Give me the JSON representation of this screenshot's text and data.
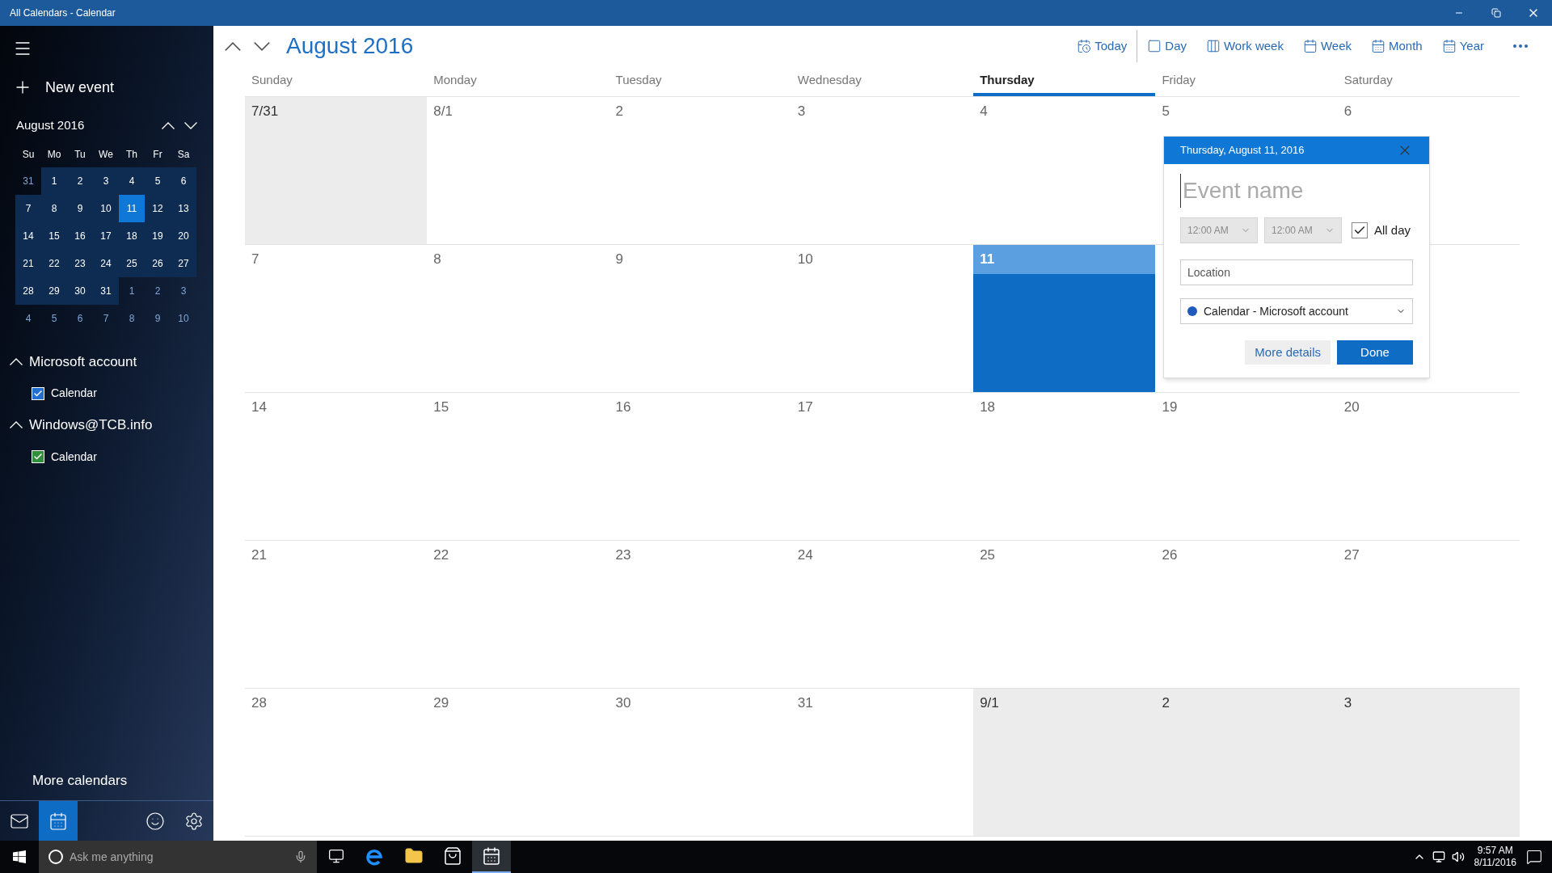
{
  "window": {
    "title": "All Calendars - Calendar"
  },
  "sidebar": {
    "new_event": "New event",
    "mini_calendar": {
      "title": "August 2016",
      "weekdays": [
        "Su",
        "Mo",
        "Tu",
        "We",
        "Th",
        "Fr",
        "Sa"
      ],
      "weeks": [
        [
          {
            "label": "31",
            "in_month": false,
            "selected": false
          },
          {
            "label": "1",
            "in_month": true,
            "selected": false
          },
          {
            "label": "2",
            "in_month": true,
            "selected": false
          },
          {
            "label": "3",
            "in_month": true,
            "selected": false
          },
          {
            "label": "4",
            "in_month": true,
            "selected": false
          },
          {
            "label": "5",
            "in_month": true,
            "selected": false
          },
          {
            "label": "6",
            "in_month": true,
            "selected": false
          }
        ],
        [
          {
            "label": "7",
            "in_month": true,
            "selected": false
          },
          {
            "label": "8",
            "in_month": true,
            "selected": false
          },
          {
            "label": "9",
            "in_month": true,
            "selected": false
          },
          {
            "label": "10",
            "in_month": true,
            "selected": false
          },
          {
            "label": "11",
            "in_month": true,
            "selected": true
          },
          {
            "label": "12",
            "in_month": true,
            "selected": false
          },
          {
            "label": "13",
            "in_month": true,
            "selected": false
          }
        ],
        [
          {
            "label": "14",
            "in_month": true,
            "selected": false
          },
          {
            "label": "15",
            "in_month": true,
            "selected": false
          },
          {
            "label": "16",
            "in_month": true,
            "selected": false
          },
          {
            "label": "17",
            "in_month": true,
            "selected": false
          },
          {
            "label": "18",
            "in_month": true,
            "selected": false
          },
          {
            "label": "19",
            "in_month": true,
            "selected": false
          },
          {
            "label": "20",
            "in_month": true,
            "selected": false
          }
        ],
        [
          {
            "label": "21",
            "in_month": true,
            "selected": false
          },
          {
            "label": "22",
            "in_month": true,
            "selected": false
          },
          {
            "label": "23",
            "in_month": true,
            "selected": false
          },
          {
            "label": "24",
            "in_month": true,
            "selected": false
          },
          {
            "label": "25",
            "in_month": true,
            "selected": false
          },
          {
            "label": "26",
            "in_month": true,
            "selected": false
          },
          {
            "label": "27",
            "in_month": true,
            "selected": false
          }
        ],
        [
          {
            "label": "28",
            "in_month": true,
            "selected": false
          },
          {
            "label": "29",
            "in_month": true,
            "selected": false
          },
          {
            "label": "30",
            "in_month": true,
            "selected": false
          },
          {
            "label": "31",
            "in_month": true,
            "selected": false
          },
          {
            "label": "1",
            "in_month": false,
            "selected": false
          },
          {
            "label": "2",
            "in_month": false,
            "selected": false
          },
          {
            "label": "3",
            "in_month": false,
            "selected": false
          }
        ],
        [
          {
            "label": "4",
            "in_month": false,
            "selected": false
          },
          {
            "label": "5",
            "in_month": false,
            "selected": false
          },
          {
            "label": "6",
            "in_month": false,
            "selected": false
          },
          {
            "label": "7",
            "in_month": false,
            "selected": false
          },
          {
            "label": "8",
            "in_month": false,
            "selected": false
          },
          {
            "label": "9",
            "in_month": false,
            "selected": false
          },
          {
            "label": "10",
            "in_month": false,
            "selected": false
          }
        ]
      ]
    },
    "accounts": [
      {
        "name": "Microsoft account",
        "expanded": true,
        "calendars": [
          {
            "label": "Calendar",
            "checked": true,
            "color": "#1f6fd1"
          }
        ]
      },
      {
        "name": "Windows@TCB.info",
        "expanded": true,
        "calendars": [
          {
            "label": "Calendar",
            "checked": true,
            "color": "#2f8f3a"
          }
        ]
      }
    ],
    "more_calendars": "More calendars",
    "bottom_nav": [
      {
        "kind": "mail",
        "selected": false
      },
      {
        "kind": "calendar",
        "selected": true
      },
      {
        "kind": "feedback",
        "selected": false
      },
      {
        "kind": "settings",
        "selected": false
      }
    ]
  },
  "toolbar": {
    "title": "August 2016",
    "views": [
      {
        "kind": "today",
        "label": "Today"
      },
      {
        "kind": "day",
        "label": "Day"
      },
      {
        "kind": "workweek",
        "label": "Work week"
      },
      {
        "kind": "week",
        "label": "Week"
      },
      {
        "kind": "month",
        "label": "Month"
      },
      {
        "kind": "year",
        "label": "Year"
      }
    ]
  },
  "month_grid": {
    "weekdays": [
      {
        "label": "Sunday",
        "selected": false
      },
      {
        "label": "Monday",
        "selected": false
      },
      {
        "label": "Tuesday",
        "selected": false
      },
      {
        "label": "Wednesday",
        "selected": false
      },
      {
        "label": "Thursday",
        "selected": true
      },
      {
        "label": "Friday",
        "selected": false
      },
      {
        "label": "Saturday",
        "selected": false
      }
    ],
    "weeks": [
      [
        {
          "label": "7/31",
          "in_month": false,
          "today": false
        },
        {
          "label": "8/1",
          "in_month": true,
          "today": false
        },
        {
          "label": "2",
          "in_month": true,
          "today": false
        },
        {
          "label": "3",
          "in_month": true,
          "today": false
        },
        {
          "label": "4",
          "in_month": true,
          "today": false
        },
        {
          "label": "5",
          "in_month": true,
          "today": false
        },
        {
          "label": "6",
          "in_month": true,
          "today": false
        }
      ],
      [
        {
          "label": "7",
          "in_month": true,
          "today": false
        },
        {
          "label": "8",
          "in_month": true,
          "today": false
        },
        {
          "label": "9",
          "in_month": true,
          "today": false
        },
        {
          "label": "10",
          "in_month": true,
          "today": false
        },
        {
          "label": "11",
          "in_month": true,
          "today": true
        },
        {
          "in_month": true,
          "today": false
        },
        {
          "in_month": true,
          "today": false
        }
      ],
      [
        {
          "label": "14",
          "in_month": true,
          "today": false
        },
        {
          "label": "15",
          "in_month": true,
          "today": false
        },
        {
          "label": "16",
          "in_month": true,
          "today": false
        },
        {
          "label": "17",
          "in_month": true,
          "today": false
        },
        {
          "label": "18",
          "in_month": true,
          "today": false
        },
        {
          "label": "19",
          "in_month": true,
          "today": false
        },
        {
          "label": "20",
          "in_month": true,
          "today": false
        }
      ],
      [
        {
          "label": "21",
          "in_month": true,
          "today": false
        },
        {
          "label": "22",
          "in_month": true,
          "today": false
        },
        {
          "label": "23",
          "in_month": true,
          "today": false
        },
        {
          "label": "24",
          "in_month": true,
          "today": false
        },
        {
          "label": "25",
          "in_month": true,
          "today": false
        },
        {
          "label": "26",
          "in_month": true,
          "today": false
        },
        {
          "label": "27",
          "in_month": true,
          "today": false
        }
      ],
      [
        {
          "label": "28",
          "in_month": true,
          "today": false
        },
        {
          "label": "29",
          "in_month": true,
          "today": false
        },
        {
          "label": "30",
          "in_month": true,
          "today": false
        },
        {
          "label": "31",
          "in_month": true,
          "today": false
        },
        {
          "label": "9/1",
          "in_month": false,
          "today": false
        },
        {
          "label": "2",
          "in_month": false,
          "today": false
        },
        {
          "label": "3",
          "in_month": false,
          "today": false
        }
      ]
    ]
  },
  "event_popup": {
    "title": "Thursday, August 11, 2016",
    "name_placeholder": "Event name",
    "start_time": "12:00 AM",
    "end_time": "12:00 AM",
    "all_day": {
      "label": "All day",
      "checked": true
    },
    "location_placeholder": "Location",
    "calendar": {
      "label": "Calendar - Microsoft account",
      "color": "#1f5bbf"
    },
    "more_details": "More details",
    "done": "Done"
  },
  "taskbar": {
    "search_placeholder": "Ask me anything",
    "apps": [
      {
        "kind": "taskview",
        "selected": false
      },
      {
        "kind": "browser",
        "selected": false
      },
      {
        "kind": "folder",
        "selected": false
      },
      {
        "kind": "store",
        "selected": false
      },
      {
        "kind": "calendar",
        "selected": true
      }
    ],
    "time": "9:57 AM",
    "date": "8/11/2016"
  }
}
